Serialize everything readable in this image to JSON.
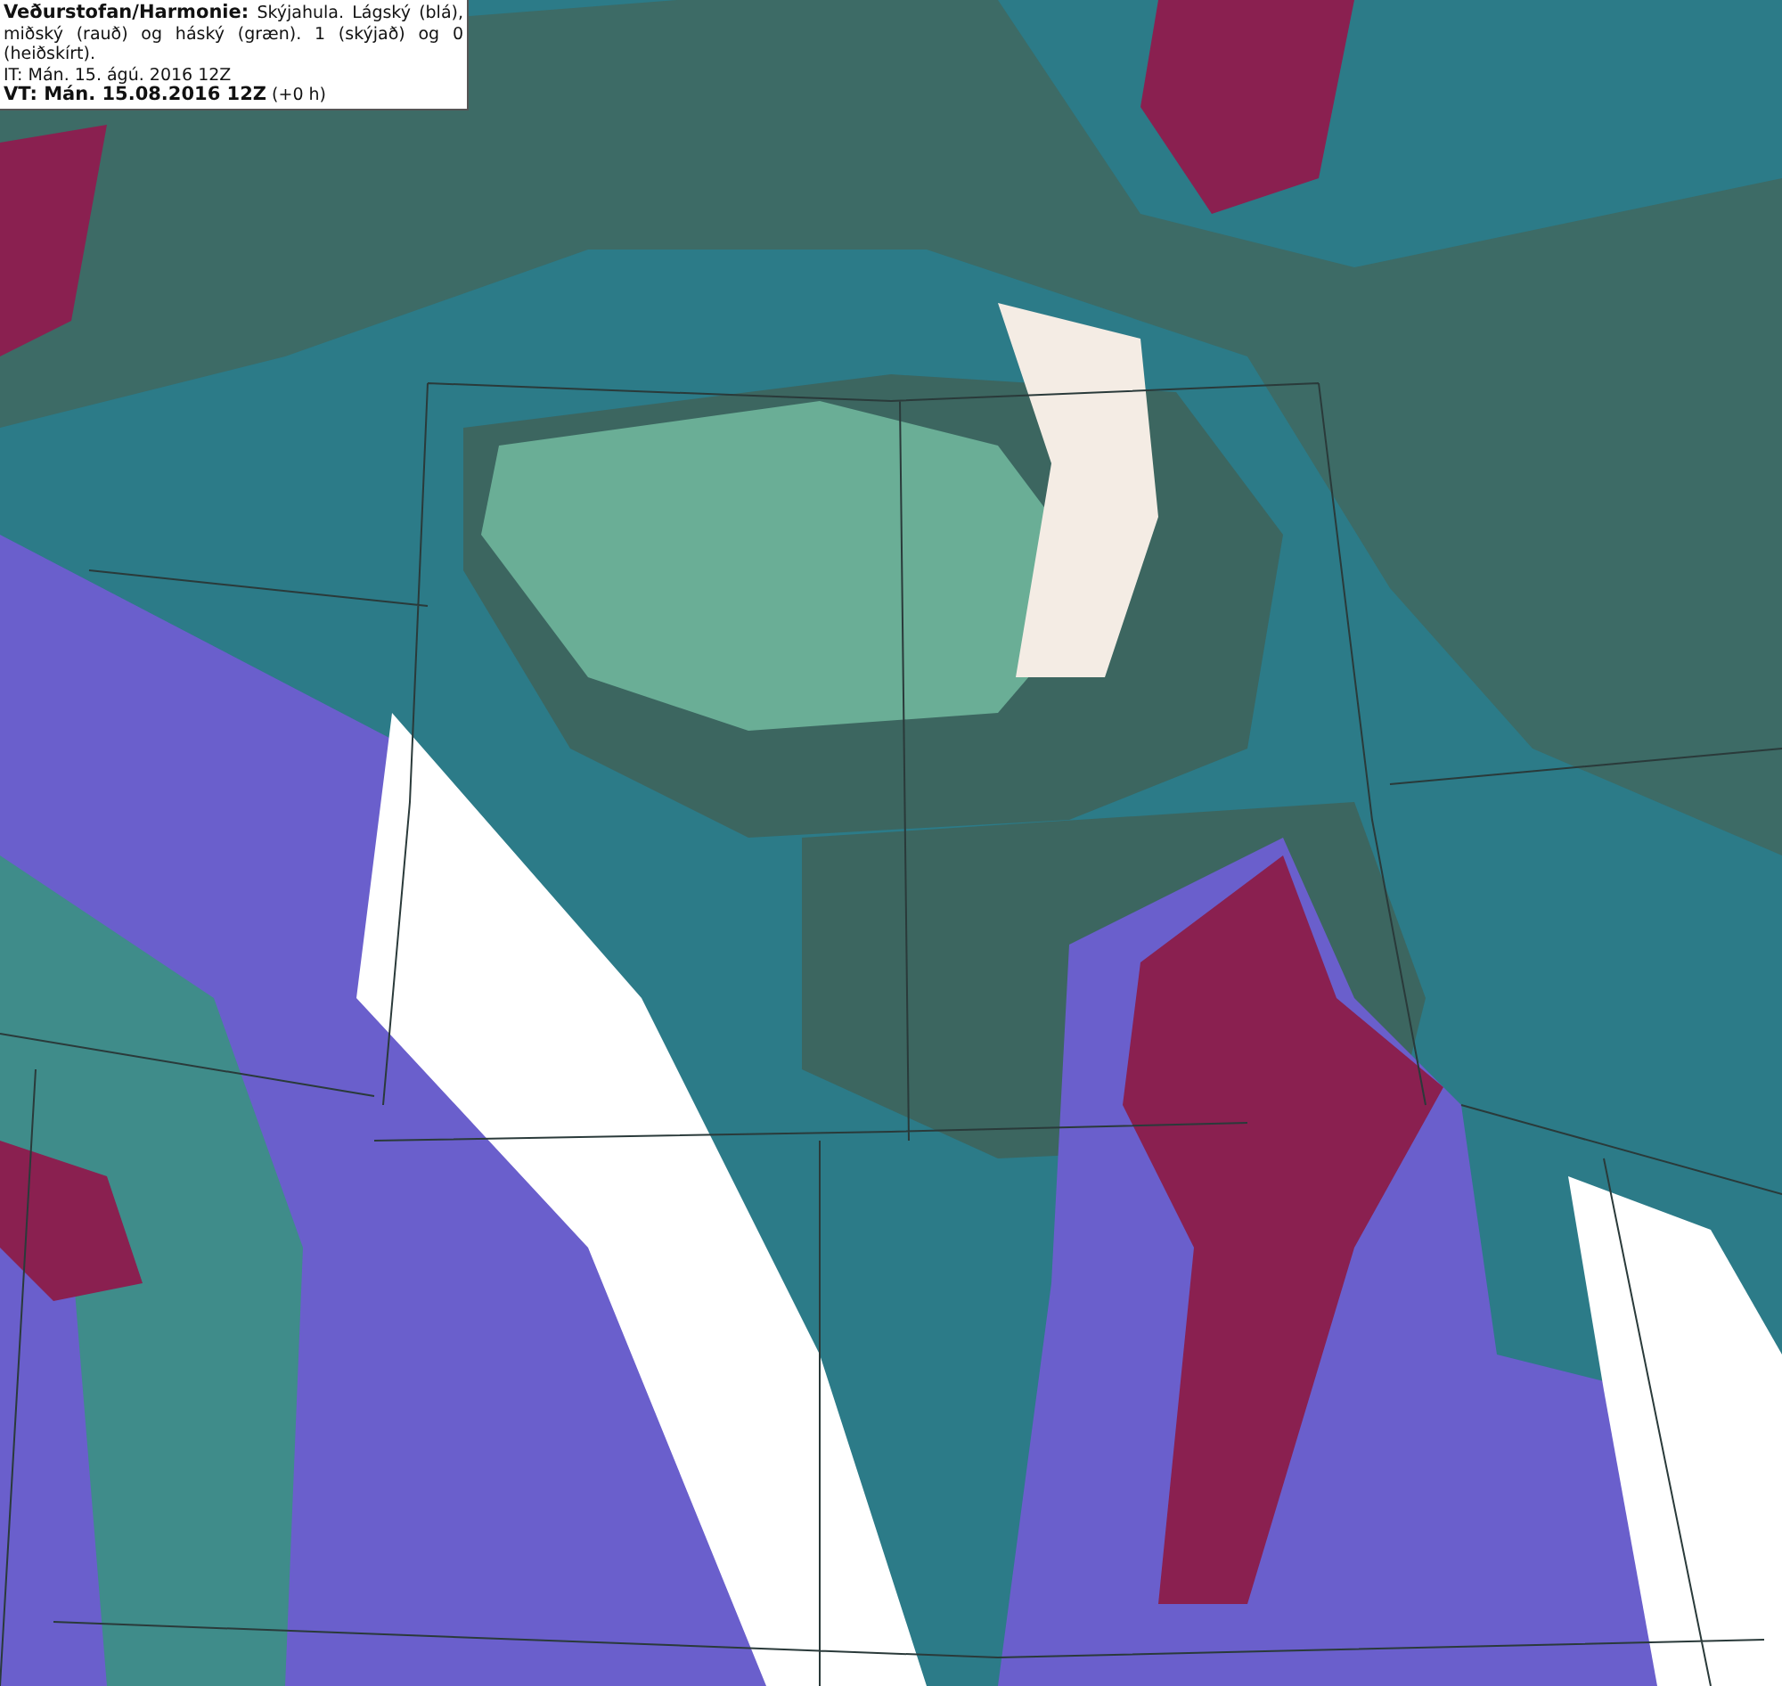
{
  "legend": {
    "description": "**Veðurstofan/Harmonie:** Skýjahula. Lágský (blá), miðský (rauð) og háský (græn). 1 (skýjað) og 0 (heiðskírt).",
    "issue_time": "IT: Mán. 15. ágú. 2016 12Z",
    "valid_time": "**VT: Mán. 15.08.2016 12Z** (+0 h)"
  }
}
